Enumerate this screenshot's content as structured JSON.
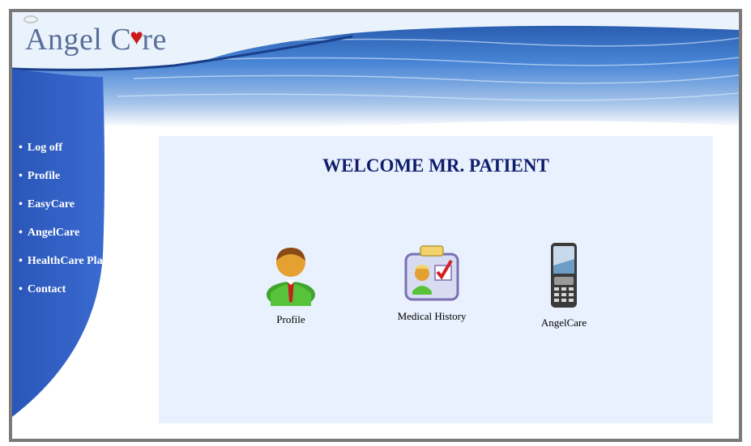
{
  "brand": {
    "prefix": "Angel C",
    "heart": "♥",
    "suffix": "re"
  },
  "nav": {
    "items": [
      {
        "label": "Log off"
      },
      {
        "label": "Profile"
      },
      {
        "label": "EasyCare"
      },
      {
        "label": "AngelCare"
      },
      {
        "label": "HealthCare Plan"
      },
      {
        "label": "Contact"
      }
    ]
  },
  "main": {
    "title": "WELCOME MR. PATIENT",
    "tiles": [
      {
        "label": "Profile",
        "icon": "user-avatar-icon"
      },
      {
        "label": "Medical History",
        "icon": "medical-record-icon"
      },
      {
        "label": "AngelCare",
        "icon": "mobile-phone-icon"
      }
    ]
  },
  "colors": {
    "sidebar": "#2f5fc4",
    "water": "#3b74c9",
    "content_bg": "#e8f1fd",
    "title": "#101d6b",
    "frame": "#7a7a7a"
  }
}
